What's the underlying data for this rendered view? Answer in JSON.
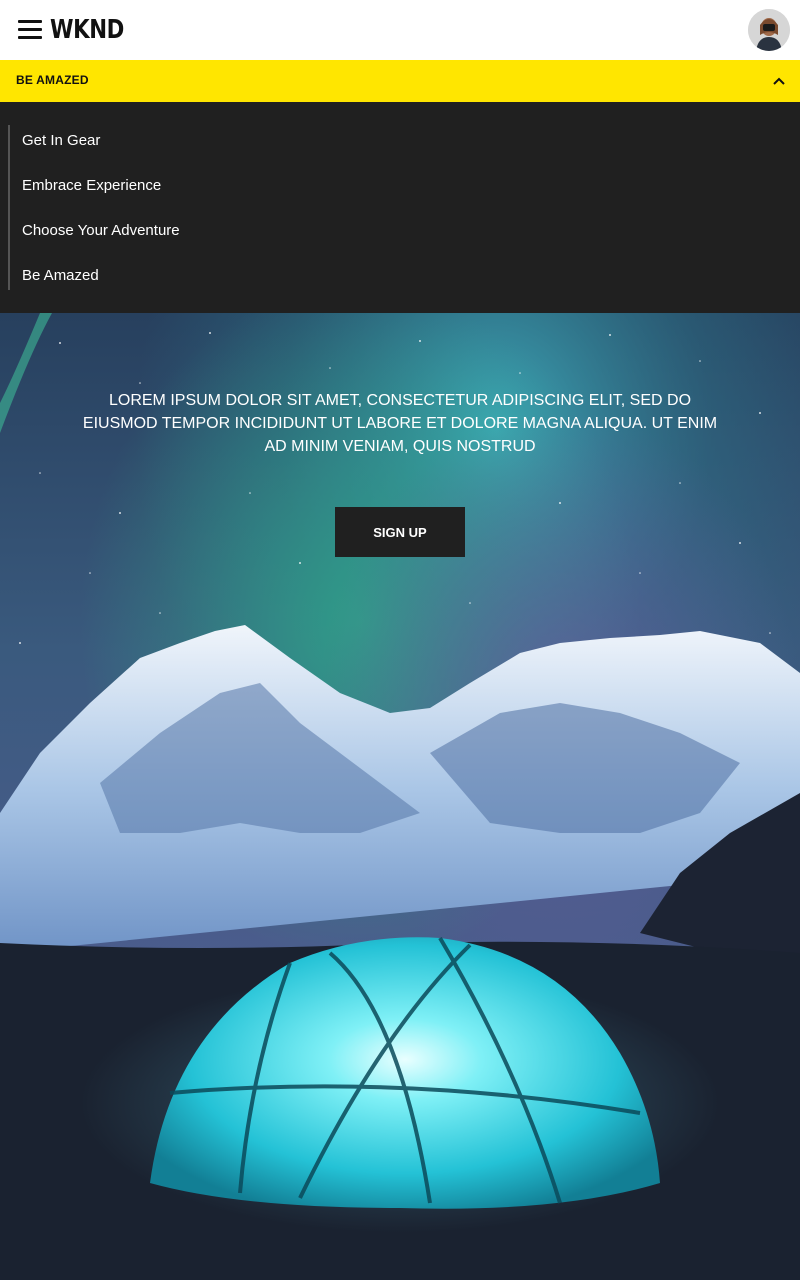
{
  "header": {
    "logo": "WKND",
    "menu_icon": "hamburger-menu-icon",
    "avatar_icon": "user-avatar"
  },
  "nav": {
    "current_label": "BE AMAZED",
    "toggle_icon": "chevron-up-icon",
    "items": [
      {
        "label": "Get In Gear"
      },
      {
        "label": "Embrace Experience"
      },
      {
        "label": "Choose Your Adventure"
      },
      {
        "label": "Be Amazed"
      }
    ]
  },
  "hero": {
    "text": "LOREM IPSUM DOLOR SIT AMET, CONSECTETUR ADIPISCING ELIT, SED DO EIUSMOD TEMPOR INCIDIDUNT UT LABORE ET DOLORE MAGNA ALIQUA. UT ENIM AD MINIM VENIAM, QUIS NOSTRUD",
    "cta_label": "SIGN UP"
  },
  "colors": {
    "accent_yellow": "#ffe600",
    "dark": "#202020",
    "tent": "#2fd3e0"
  }
}
